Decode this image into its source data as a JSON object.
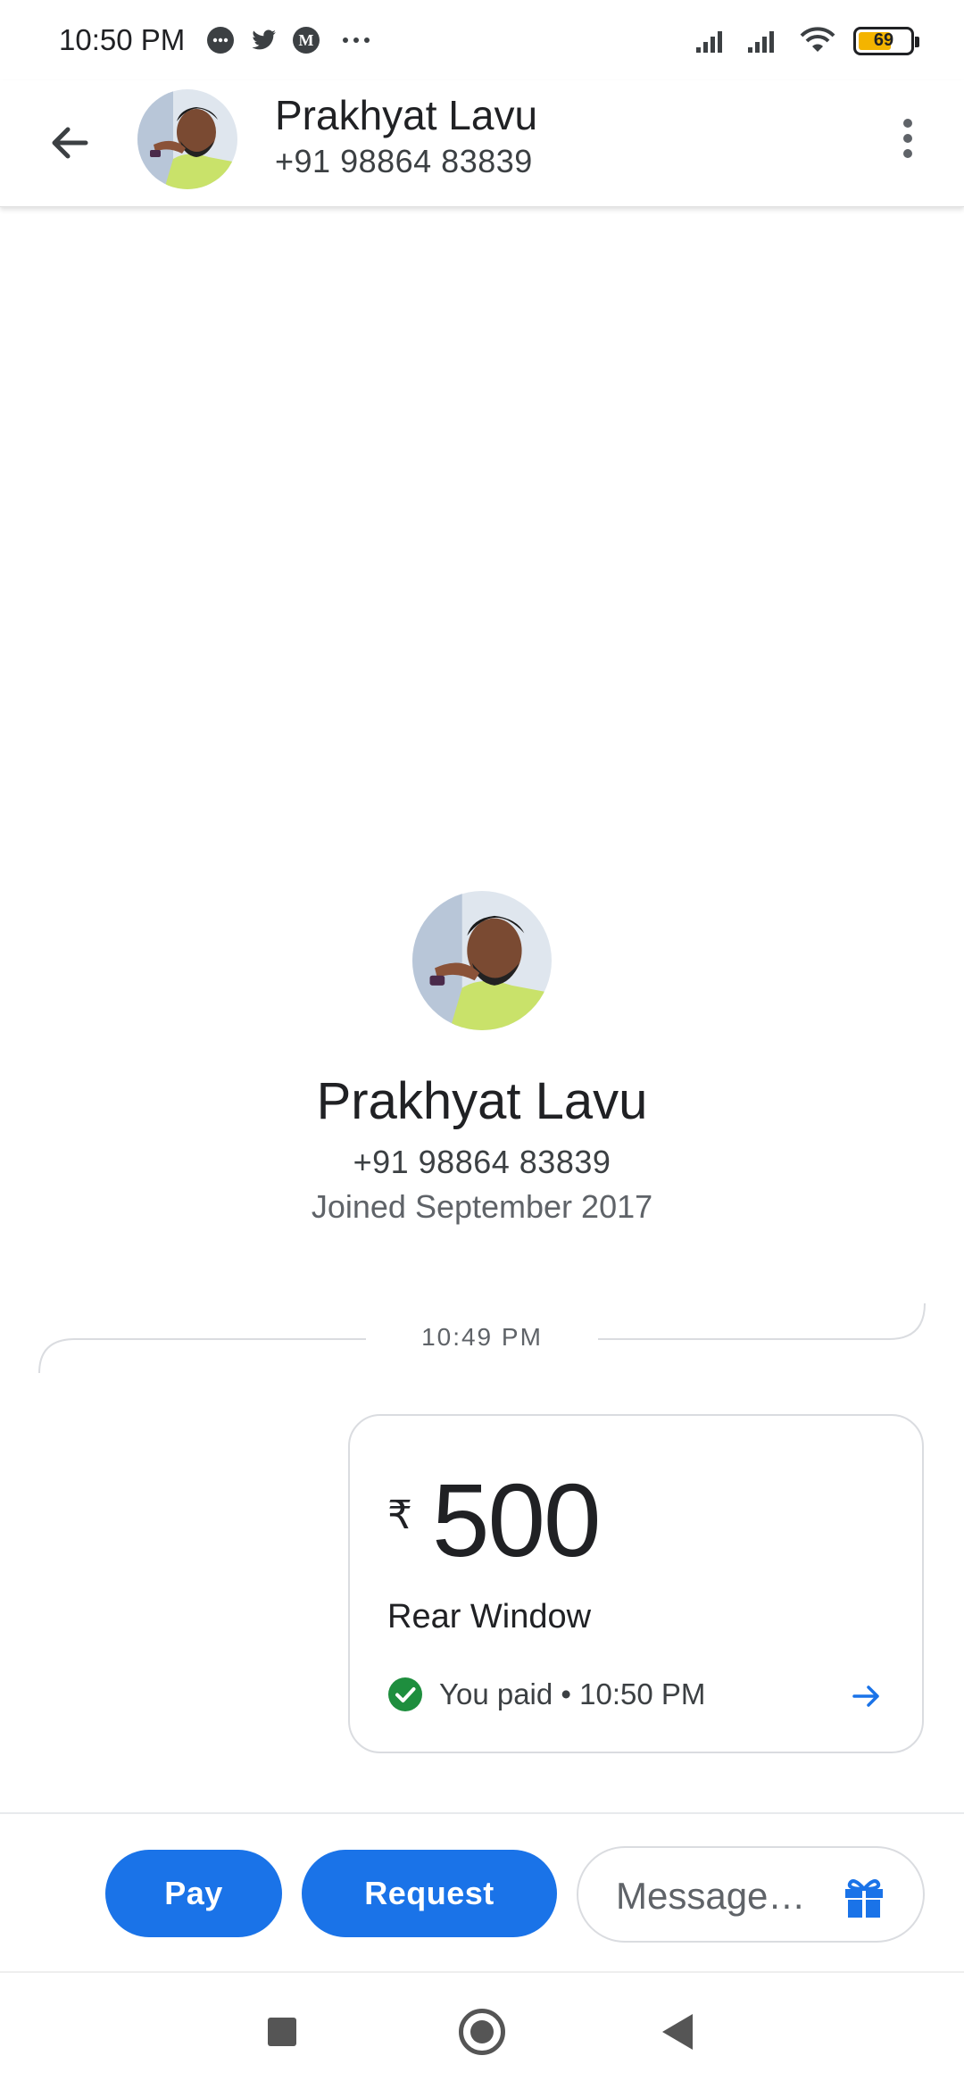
{
  "status_bar": {
    "time": "10:50 PM",
    "battery": "69",
    "left_icons": [
      "chat-bubble-icon",
      "twitter-icon",
      "medium-icon",
      "more-notifications-icon"
    ],
    "right_icons": [
      "signal-icon",
      "signal-icon",
      "wifi-icon",
      "battery-icon"
    ]
  },
  "header": {
    "contact_name": "Prakhyat Lavu",
    "contact_phone": "+91 98864 83839",
    "back_icon": "arrow-back-icon",
    "menu_icon": "more-vert-icon"
  },
  "profile": {
    "name": "Prakhyat Lavu",
    "phone": "+91 98864 83839",
    "joined": "Joined September 2017"
  },
  "timeline": {
    "time": "10:49 PM"
  },
  "payment": {
    "currency_symbol": "₹",
    "amount": "500",
    "note": "Rear Window",
    "status": "You paid • 10:50 PM",
    "status_color": "#1e8e3e"
  },
  "actions": {
    "pay_label": "Pay",
    "request_label": "Request",
    "message_placeholder": "Message…",
    "accent": "#1a73e8"
  },
  "nav": {
    "items": [
      "recents-button",
      "home-button",
      "back-button"
    ]
  }
}
